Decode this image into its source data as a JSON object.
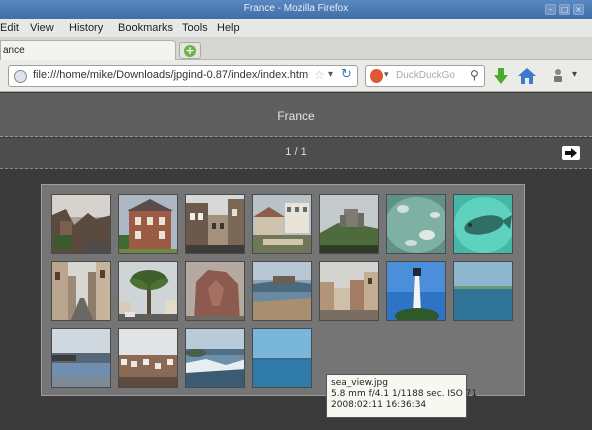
{
  "window": {
    "title": "France - Mozilla Firefox"
  },
  "menubar": {
    "items": [
      "Edit",
      "View",
      "History",
      "Bookmarks",
      "Tools",
      "Help"
    ]
  },
  "tabs": [
    {
      "label": "ance"
    }
  ],
  "navbar": {
    "url": "file:///home/mike/Downloads/jpgind-0.87/index/index.htm",
    "search_placeholder": "DuckDuckGo"
  },
  "gallery": {
    "title": "France",
    "page_counter": "1 / 1",
    "thumbnails": [
      "street-dusk",
      "brick-mansion",
      "old-buildings",
      "harbor-houses",
      "hill-castle",
      "seal-underwater-1",
      "seal-underwater-2",
      "narrow-street",
      "palm-tree",
      "rock-statue",
      "beach-bay",
      "cloudy-town",
      "lighthouse",
      "calm-sea",
      "coast-town",
      "seaside-town",
      "sea-waves",
      "sea-view"
    ]
  },
  "tooltip": {
    "filename": "sea_view.jpg",
    "exif": "5.8 mm f/4.1 1/1188 sec. ISO 71",
    "date": "2008:02:11 16:36:34"
  },
  "colors": {
    "titlebar": "#4a78b3",
    "page_background": "#3b3b3b",
    "header_band": "#5f5f5f",
    "gallery_frame": "#757575"
  },
  "icons": [
    "minimize-icon",
    "maximize-icon",
    "close-icon",
    "new-tab-icon",
    "globe-icon",
    "bookmark-star-icon",
    "reload-icon",
    "search-icon",
    "download-icon",
    "home-icon",
    "addon-icon",
    "next-arrow-icon"
  ]
}
